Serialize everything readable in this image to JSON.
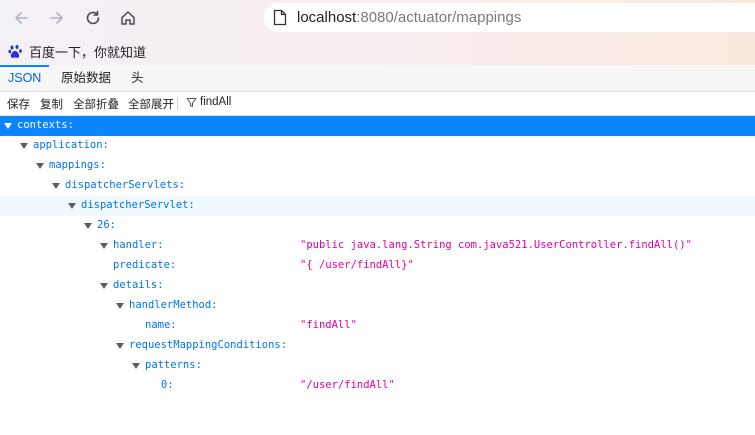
{
  "browser": {
    "url_host": "localhost",
    "url_path": ":8080/actuator/mappings",
    "bookmark_label": "百度一下，你就知道",
    "colors": {
      "accent": "#0a84ff",
      "tab_active": "#0061e0"
    }
  },
  "viewer": {
    "tabs": [
      {
        "label": "JSON"
      },
      {
        "label": "原始数据"
      },
      {
        "label": "头"
      }
    ],
    "toolbar": {
      "save": "保存",
      "copy": "复制",
      "collapse_all": "全部折叠",
      "expand_all": "全部展开",
      "filter_value": "findAll"
    }
  },
  "json_tree": {
    "colors": {
      "key": "#0074e8",
      "string": "#dd00a9",
      "selected_bg": "#0a84ff",
      "hover_bg": "#f0f9fe"
    },
    "rows": [
      {
        "key": "contexts:",
        "value": ""
      },
      {
        "key": "application:",
        "value": ""
      },
      {
        "key": "mappings:",
        "value": ""
      },
      {
        "key": "dispatcherServlets:",
        "value": ""
      },
      {
        "key": "dispatcherServlet:",
        "value": ""
      },
      {
        "key": "26:",
        "value": ""
      },
      {
        "key": "handler:",
        "value": "\"public java.lang.String com.java521.UserController.findAll()\""
      },
      {
        "key": "predicate:",
        "value": "\"{ /user/findAll}\""
      },
      {
        "key": "details:",
        "value": ""
      },
      {
        "key": "handlerMethod:",
        "value": ""
      },
      {
        "key": "name:",
        "value": "\"findAll\""
      },
      {
        "key": "requestMappingConditions:",
        "value": ""
      },
      {
        "key": "patterns:",
        "value": ""
      },
      {
        "key": "0:",
        "value": "\"/user/findAll\""
      }
    ]
  }
}
